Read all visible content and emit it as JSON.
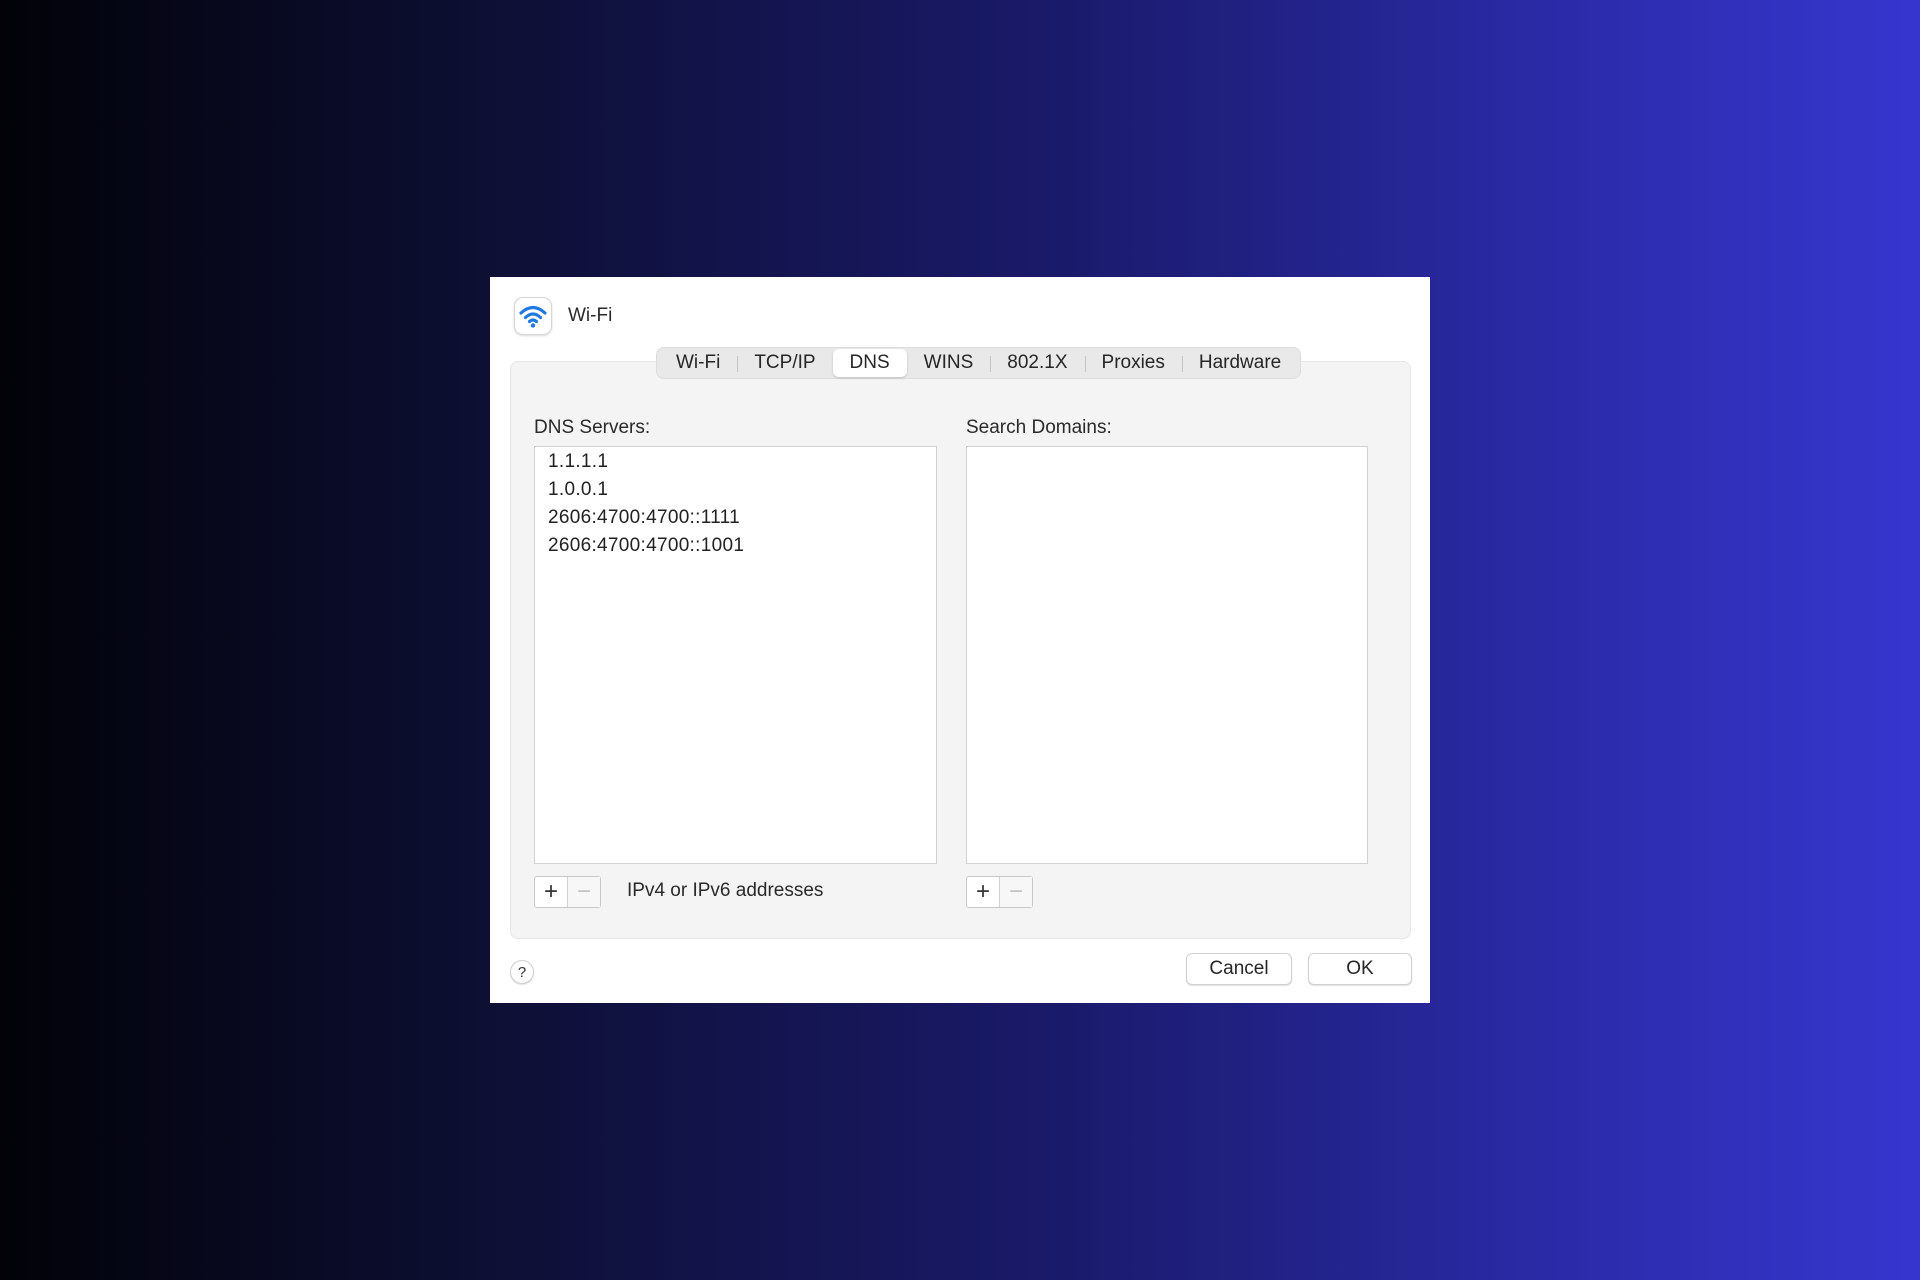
{
  "window": {
    "title": "Wi-Fi",
    "icon": "wifi-icon",
    "accent_color": "#1e7ae0"
  },
  "tabs": [
    {
      "label": "Wi-Fi"
    },
    {
      "label": "TCP/IP"
    },
    {
      "label": "DNS",
      "selected": true
    },
    {
      "label": "WINS"
    },
    {
      "label": "802.1X"
    },
    {
      "label": "Proxies"
    },
    {
      "label": "Hardware"
    }
  ],
  "dns": {
    "servers_label": "DNS Servers:",
    "servers": [
      "1.1.1.1",
      "1.0.0.1",
      "2606:4700:4700::1111",
      "2606:4700:4700::1001"
    ],
    "add_symbol": "+",
    "remove_symbol": "−",
    "hint": "IPv4 or IPv6 addresses",
    "search_domains_label": "Search Domains:",
    "search_domains": [],
    "search_add_symbol": "+",
    "search_remove_symbol": "−"
  },
  "footer": {
    "help_label": "?",
    "cancel_label": "Cancel",
    "ok_label": "OK"
  }
}
